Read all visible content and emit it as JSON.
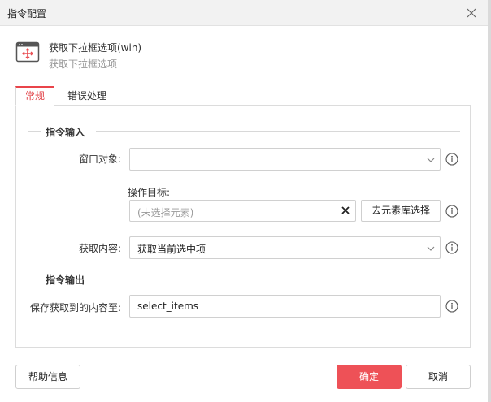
{
  "dialog": {
    "title": "指令配置",
    "close_icon": "close-icon"
  },
  "command": {
    "icon": "window-move-icon",
    "name": "获取下拉框选项(win)",
    "description": "获取下拉框选项"
  },
  "tabs": [
    {
      "label": "常规",
      "active": true
    },
    {
      "label": "错误处理",
      "active": false
    }
  ],
  "sections": {
    "input": "指令输入",
    "output": "指令输出"
  },
  "fields": {
    "window_object": {
      "label": "窗口对象:",
      "value": "",
      "icon": "chevron-down-icon"
    },
    "operation_target": {
      "label": "操作目标:",
      "placeholder": "(未选择元素)",
      "clear_icon": "clear-icon",
      "button": "去元素库选择"
    },
    "content": {
      "label": "获取内容:",
      "value": "获取当前选中项",
      "icon": "chevron-down-icon"
    },
    "save_to": {
      "label": "保存获取到的内容至:",
      "value": "select_items"
    }
  },
  "buttons": {
    "help": "帮助信息",
    "ok": "确定",
    "cancel": "取消"
  },
  "colors": {
    "accent": "#ee5157",
    "active_tab_text": "#e0383e"
  }
}
